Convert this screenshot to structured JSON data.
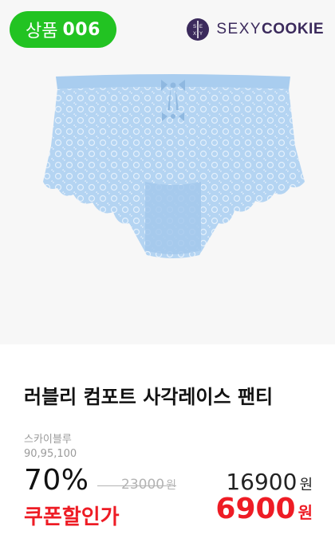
{
  "badge": {
    "prefix": "상품",
    "number": "006"
  },
  "brand": {
    "name_light": "SEXY",
    "name_bold": "COOKIE",
    "accent_color": "#3b2a5c"
  },
  "product": {
    "title": "러블리 컴포트 사각레이스 팬티",
    "color": "스카이블루",
    "sizes": "90,95,100",
    "image_icon": "lace-panty-image"
  },
  "pricing": {
    "discount": "70%",
    "original_price": "23000",
    "sale_price": "16900",
    "currency": "원",
    "coupon_label": "쿠폰할인가",
    "coupon_price": "6900",
    "accent_color": "#ee1c25"
  }
}
